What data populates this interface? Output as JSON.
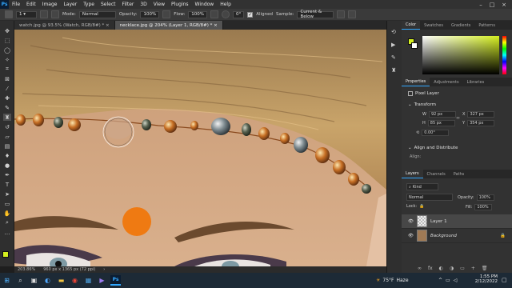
{
  "menu": {
    "logo": "Ps",
    "items": [
      "File",
      "Edit",
      "Image",
      "Layer",
      "Type",
      "Select",
      "Filter",
      "3D",
      "View",
      "Plugins",
      "Window",
      "Help"
    ]
  },
  "options": {
    "brush_size": "1",
    "mode_label": "Mode:",
    "mode_value": "Normal",
    "opacity_label": "Opacity:",
    "opacity_value": "100%",
    "flow_label": "Flow:",
    "flow_value": "100%",
    "angle_value": "0°",
    "aligned_label": "Aligned",
    "sample_label": "Sample:",
    "sample_value": "Current & Below"
  },
  "tabs": [
    {
      "label": "watch.jpg @ 93.5% (Watch, RGB/8#) *",
      "active": false
    },
    {
      "label": "necklace.jpg @ 204% (Layer 1, RGB/8#) *",
      "active": true
    }
  ],
  "status": {
    "zoom": "203.86%",
    "doc_size": "960 px x 1365 px (72 ppi)"
  },
  "color_panel": {
    "tabs": [
      "Color",
      "Swatches",
      "Gradients",
      "Patterns"
    ],
    "fg_color": "#d5f020",
    "bg_color": "#ffffff"
  },
  "properties_panel": {
    "tabs": [
      "Properties",
      "Adjustments",
      "Libraries"
    ],
    "layer_kind": "Pixel Layer",
    "transform_title": "Transform",
    "w_label": "W",
    "w_value": "92 px",
    "x_label": "X",
    "x_value": "327 px",
    "h_label": "H",
    "h_value": "85 px",
    "y_label": "Y",
    "y_value": "354 px",
    "angle_value": "0.00°",
    "align_title": "Align and Distribute",
    "align_sub": "Align:"
  },
  "layers_panel": {
    "tabs": [
      "Layers",
      "Channels",
      "Paths"
    ],
    "filter_label": "Kind",
    "blend_mode": "Normal",
    "opacity_label": "Opacity:",
    "opacity_value": "100%",
    "lock_label": "Lock:",
    "fill_label": "Fill:",
    "fill_value": "100%",
    "layers": [
      {
        "name": "Layer 1",
        "selected": true
      },
      {
        "name": "Background",
        "selected": false
      }
    ]
  },
  "taskbar": {
    "temperature": "75°F",
    "weather": "Haze",
    "time": "1:55 PM",
    "date": "2/12/2022"
  },
  "colors": {
    "accent": "#31a8ff",
    "foreground_swatch": "#d5f020",
    "marker_dot": "#ef7a12"
  }
}
